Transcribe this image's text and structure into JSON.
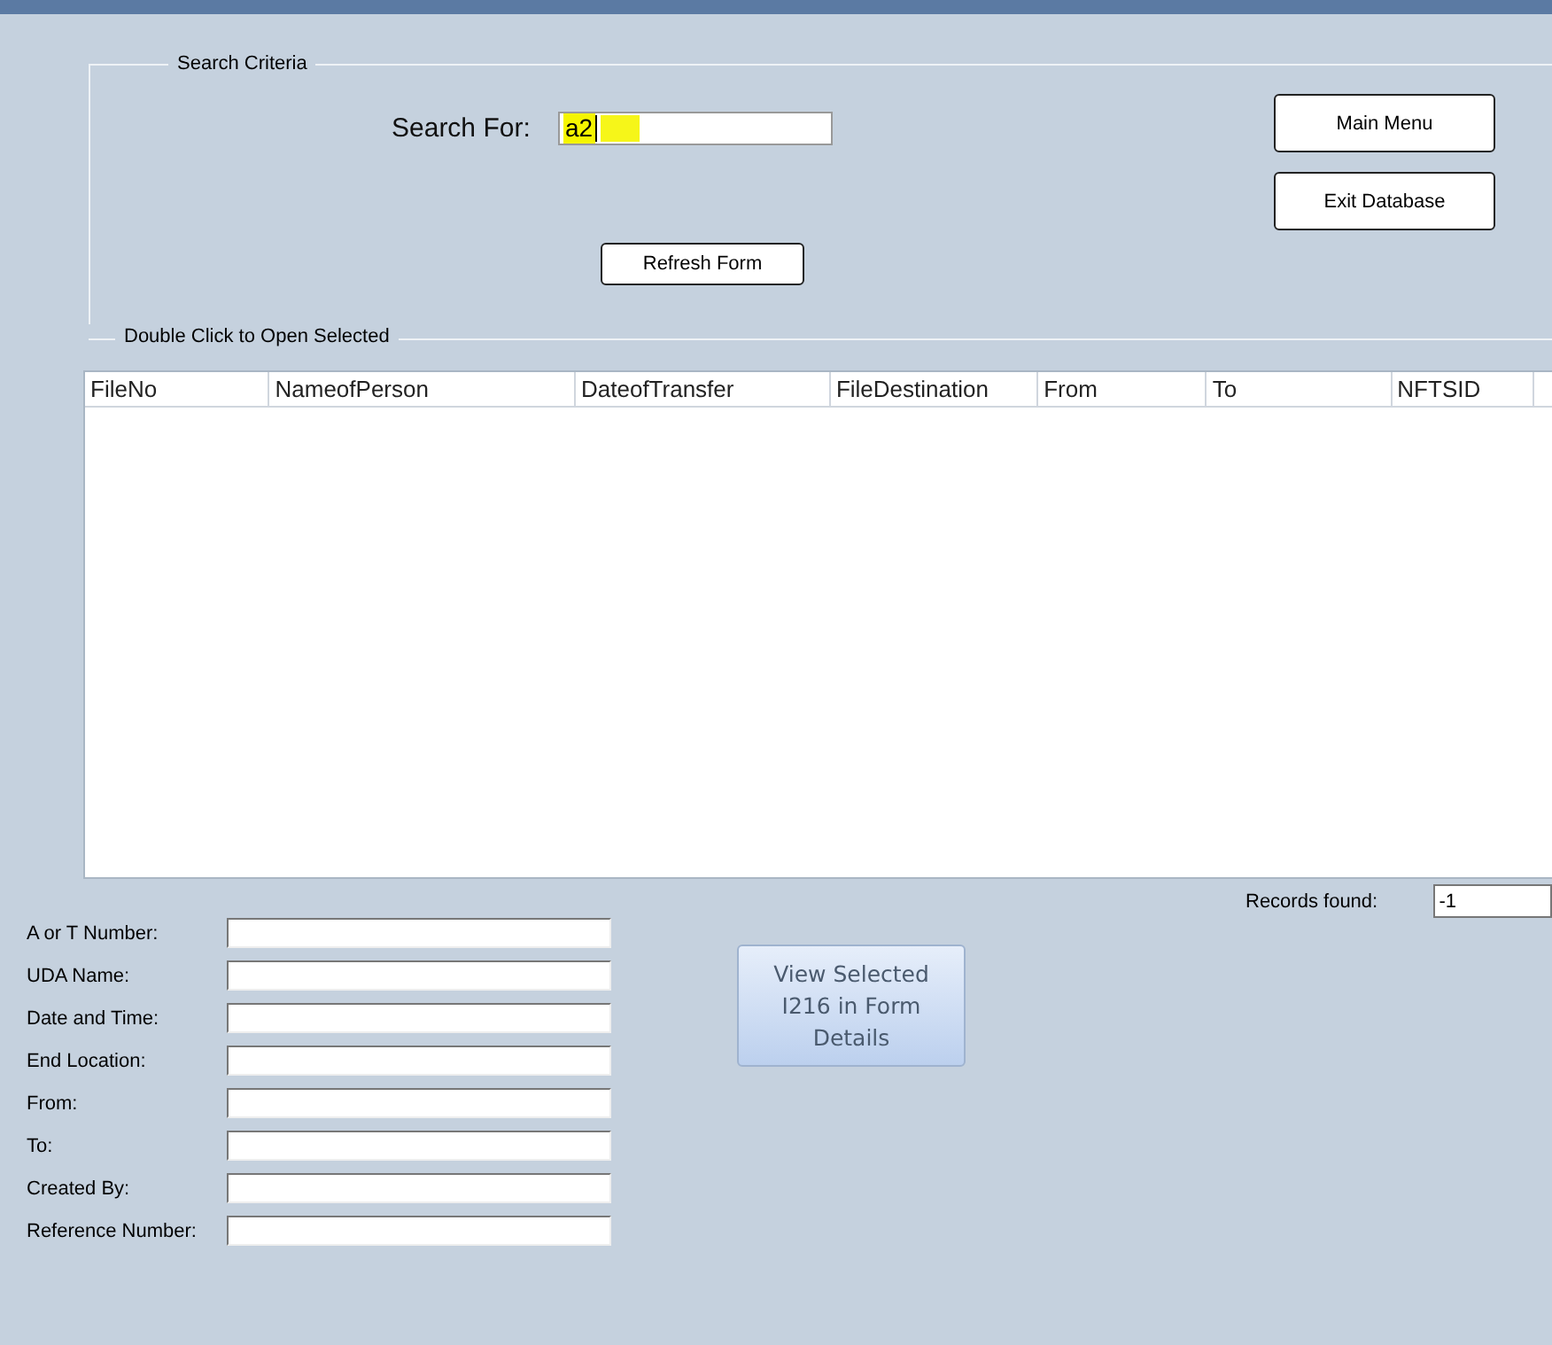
{
  "search_criteria": {
    "title": "Search Criteria",
    "search_label": "Search For:",
    "search_value": "a2",
    "refresh_button": "Refresh Form",
    "side_buttons": [
      "Main Menu",
      "Exit Database"
    ]
  },
  "results": {
    "title": "Double Click to Open Selected",
    "columns": [
      "FileNo",
      "NameofPerson",
      "DateofTransfer",
      "FileDestination",
      "From",
      "To",
      "NFTSID"
    ],
    "records_label": "Records found:",
    "records_value": "-1"
  },
  "details": [
    {
      "label": "A or T Number:"
    },
    {
      "label": "UDA Name:"
    },
    {
      "label": "Date and Time:"
    },
    {
      "label": "End Location:"
    },
    {
      "label": "From:"
    },
    {
      "label": "To:"
    },
    {
      "label": "Created By:"
    },
    {
      "label": "Reference Number:"
    }
  ],
  "view_button": "View Selected I216 in Form Details"
}
